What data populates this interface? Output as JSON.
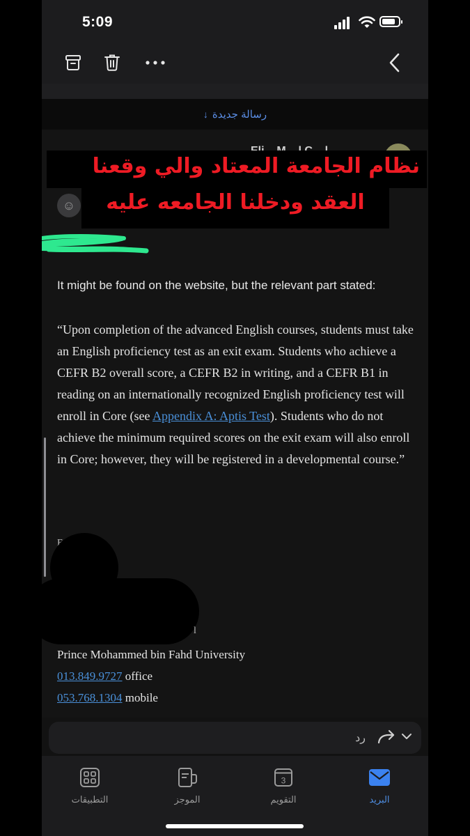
{
  "status_bar": {
    "time": "5:09",
    "battery_level": 0.8
  },
  "toolbar": {
    "archive_icon": "archive-icon",
    "trash_icon": "trash-icon",
    "more_icon": "more-icon",
    "back_icon": "back-icon"
  },
  "new_message": {
    "label": "رسالة جديدة",
    "arrow": "↓"
  },
  "sender": {
    "partial_name": "Eli... M... l C... l"
  },
  "overlay": {
    "line1": "نظام الجامعة المعتاد والي وقعنا",
    "line2": "العقد ودخلنا الجامعه عليه"
  },
  "email": {
    "intro": "It might be found on the website, but the relevant part stated:",
    "quote_before_link": "“Upon completion of the advanced English courses, students must take an English proficiency test as an exit exam. Students who achieve a CEFR B2 overall score, a CEFR B2 in writing, and a CEFR B1 in reading on an internationally recognized English proficiency test  will enroll in Core (see ",
    "quote_link": "Appendix A: Aptis Test",
    "quote_after_link": "). Students who do not achieve the minimum required scores on the exit exam will also enroll in Core; however, they will be registered in a developmental course.”",
    "stray1": "F",
    "stray2": "l"
  },
  "signature": {
    "university": "Prince Mohammed bin Fahd University",
    "office_phone": "013.849.9727",
    "office_label": " office",
    "mobile_phone": "053.768.1304",
    "mobile_label": " mobile"
  },
  "reply_bar": {
    "label": "رد"
  },
  "tabs": [
    {
      "label": "التطبيقات",
      "icon": "apps-grid-icon"
    },
    {
      "label": "الموجز",
      "icon": "feed-icon"
    },
    {
      "label": "التقويم",
      "icon": "calendar-icon",
      "day": "3"
    },
    {
      "label": "البريد",
      "icon": "mail-icon",
      "active": true
    }
  ]
}
